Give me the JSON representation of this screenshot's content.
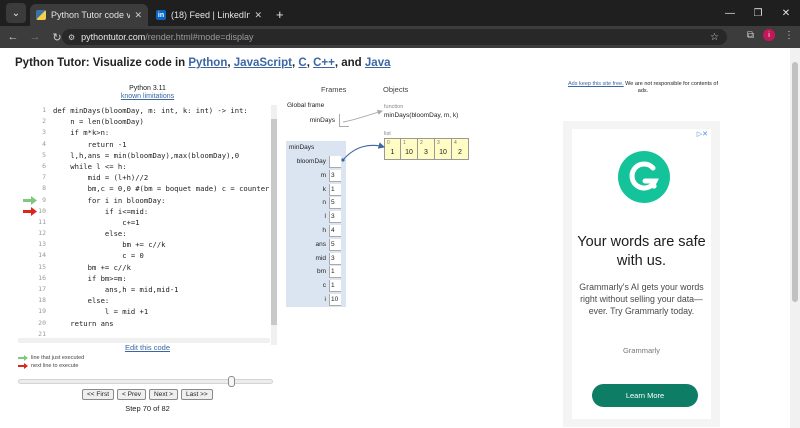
{
  "browser": {
    "tabs": [
      {
        "title": "Python Tutor code visualizer: Vi",
        "active": true,
        "icon": "python-tutor-favicon"
      },
      {
        "title": "(18) Feed | LinkedIn",
        "active": false,
        "icon": "linkedin-favicon"
      }
    ],
    "new_tab": "+",
    "url_host": "pythontutor.com",
    "url_path": "/render.html#mode=display",
    "profile_initial": "i"
  },
  "page": {
    "title_prefix": "Python Tutor: Visualize code in",
    "langs": [
      "Python",
      "JavaScript",
      "C",
      "C++",
      "Java"
    ],
    "sep_comma": ",",
    "sep_and": "and",
    "language": "Python 3.11",
    "known_limitations": "known limitations",
    "edit_link": "Edit this code",
    "legend_just_executed": "line that just executed",
    "legend_next": "next line to execute",
    "buttons": {
      "first": "<< First",
      "prev": "< Prev",
      "next": "Next >",
      "last": "Last >>"
    },
    "step_text": "Step 70 of 82",
    "bottom_text": "..."
  },
  "code": {
    "lines": [
      {
        "n": "1",
        "text": "def minDays(bloomDay, m: int, k: int) -> int:"
      },
      {
        "n": "2",
        "text": "    n = len(bloomDay)"
      },
      {
        "n": "3",
        "text": "    if m*k>n:"
      },
      {
        "n": "4",
        "text": "        return -1"
      },
      {
        "n": "5",
        "text": "    l,h,ans = min(bloomDay),max(bloomDay),0"
      },
      {
        "n": "6",
        "text": "    while l <= h:"
      },
      {
        "n": "7",
        "text": "        mid = (l+h)//2"
      },
      {
        "n": "8",
        "text": "        bm,c = 0,0 #(bm = boquet made) c = counter"
      },
      {
        "n": "9",
        "text": "        for i in bloomDay:",
        "arrow": "green"
      },
      {
        "n": "10",
        "text": "            if i<=mid:",
        "arrow": "red"
      },
      {
        "n": "11",
        "text": "                c+=1"
      },
      {
        "n": "12",
        "text": "            else:"
      },
      {
        "n": "13",
        "text": "                bm += c//k"
      },
      {
        "n": "14",
        "text": "                c = 0"
      },
      {
        "n": "15",
        "text": "        bm += c//k"
      },
      {
        "n": "16",
        "text": "        if bm>=m:"
      },
      {
        "n": "17",
        "text": "            ans,h = mid,mid-1"
      },
      {
        "n": "18",
        "text": "        else:"
      },
      {
        "n": "19",
        "text": "            l = mid +1"
      },
      {
        "n": "20",
        "text": "    return ans"
      },
      {
        "n": "21",
        "text": ""
      }
    ]
  },
  "viz": {
    "frames_label": "Frames",
    "objects_label": "Objects",
    "global_frame": "Global frame",
    "global_var": "minDays",
    "function_label": "function",
    "function_sig": "minDays(bloomDay, m, k)",
    "local_frame": "minDays",
    "local_vars": [
      {
        "name": "bloomDay",
        "value": ""
      },
      {
        "name": "m",
        "value": "3"
      },
      {
        "name": "k",
        "value": "1"
      },
      {
        "name": "n",
        "value": "5"
      },
      {
        "name": "l",
        "value": "3"
      },
      {
        "name": "h",
        "value": "4"
      },
      {
        "name": "ans",
        "value": "5"
      },
      {
        "name": "mid",
        "value": "3"
      },
      {
        "name": "bm",
        "value": "1"
      },
      {
        "name": "c",
        "value": "1"
      },
      {
        "name": "i",
        "value": "10"
      }
    ],
    "list_label": "list",
    "list_items": [
      {
        "idx": "0",
        "val": "1"
      },
      {
        "idx": "1",
        "val": "10"
      },
      {
        "idx": "2",
        "val": "3"
      },
      {
        "idx": "3",
        "val": "10"
      },
      {
        "idx": "4",
        "val": "2"
      }
    ]
  },
  "ad": {
    "note_link": "Ads keep this site free.",
    "note_rest": "We are not responsible for contents of ads.",
    "headline": "Your words are safe with us.",
    "body": "Grammarly's AI gets your words right without selling your data—ever. Try Grammarly today.",
    "brand": "Grammarly",
    "cta": "Learn More"
  },
  "colors": {
    "link": "#3c66a3",
    "frame_bg": "#dbe5f1",
    "heap_cell": "#fffcc4",
    "arrow_green": "#7fc97f",
    "arrow_red": "#d9281e",
    "grammarly": "#15c39a",
    "cta": "#0d7d65"
  }
}
